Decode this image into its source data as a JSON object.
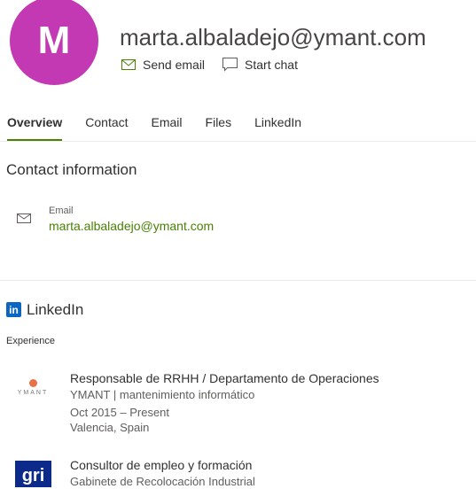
{
  "profile": {
    "initial": "M",
    "name": "marta.albaladejo@ymant.com",
    "avatar_color": "#c239b3"
  },
  "actions": {
    "send_email": "Send email",
    "start_chat": "Start chat"
  },
  "tabs": [
    "Overview",
    "Contact",
    "Email",
    "Files",
    "LinkedIn"
  ],
  "contact": {
    "heading": "Contact information",
    "email_label": "Email",
    "email": "marta.albaladejo@ymant.com"
  },
  "linkedin": {
    "heading": "LinkedIn",
    "experience_label": "Experience",
    "jobs": [
      {
        "logo": "YMANT",
        "title": "Responsable de RRHH / Departamento de Operaciones",
        "company": "YMANT | mantenimiento informático",
        "dates": "Oct 2015 – Present",
        "location": "Valencia, Spain"
      },
      {
        "logo": "gri",
        "title": "Consultor de empleo y formación",
        "company": "Gabinete de Recolocación Industrial"
      }
    ]
  },
  "accent": "#498205"
}
